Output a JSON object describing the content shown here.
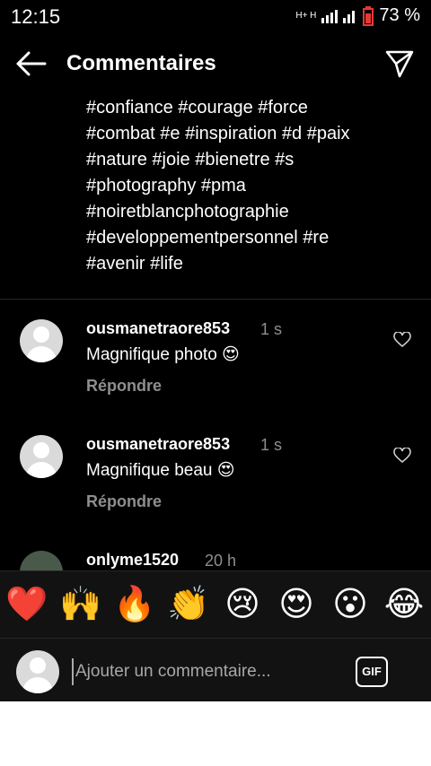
{
  "status": {
    "time": "12:15",
    "battery": "73 %",
    "network": "H+ H"
  },
  "header": {
    "title": "Commentaires"
  },
  "caption_lines": [
    "#confiance #courage #force",
    "#combat #e #inspiration #d #paix",
    "#nature #joie #bienetre #s",
    "#photography #pma",
    "#noiretblancphotographie",
    "#developpementpersonnel #re",
    "#avenir #life"
  ],
  "comments": [
    {
      "username": "ousmanetraore853",
      "time": "1 s",
      "text": "Magnifique photo 😍",
      "reply": "Répondre"
    },
    {
      "username": "ousmanetraore853",
      "time": "1 s",
      "text": "Magnifique beau 😍",
      "reply": "Répondre"
    },
    {
      "username": "onlyme1520",
      "time": "20 h",
      "text": "",
      "reply": ""
    }
  ],
  "quick_emojis": [
    "❤️",
    "🙌",
    "🔥",
    "👏",
    "😢",
    "😍",
    "😮",
    "😂"
  ],
  "input": {
    "placeholder": "Ajouter un commentaire...",
    "value": ""
  },
  "gif_label": "GIF",
  "colors": {
    "background": "#000000",
    "secondary_text": "#8e8e8e",
    "panel": "#121212"
  }
}
